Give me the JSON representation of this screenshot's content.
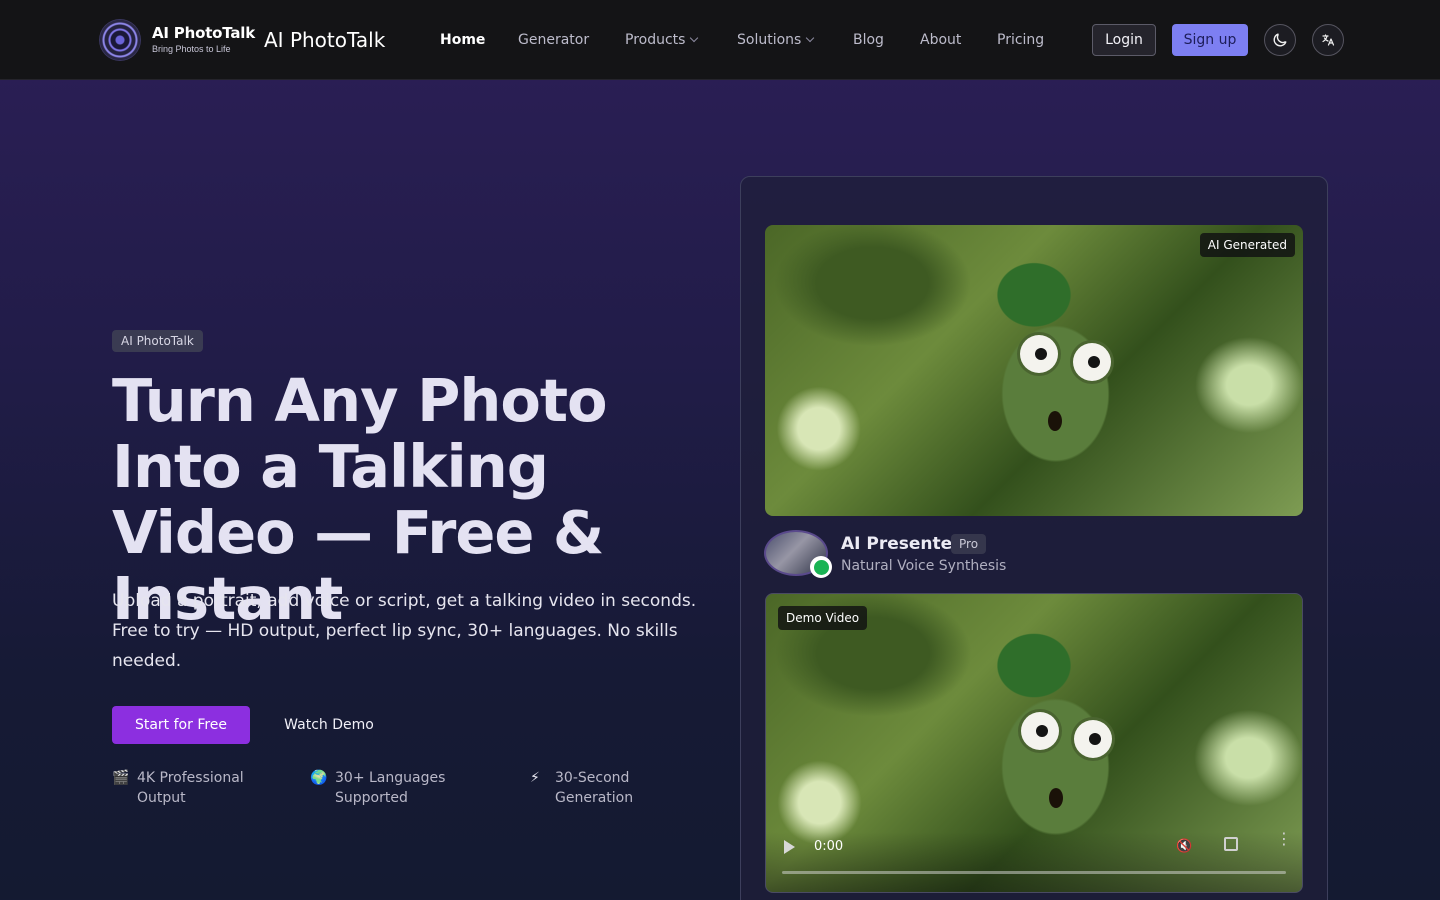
{
  "nav": {
    "logo_title": "AI PhotoTalk",
    "logo_tagline": "Bring Photos to Life",
    "brand": "AI PhotoTalk",
    "links": [
      {
        "label": "Home",
        "active": true
      },
      {
        "label": "Generator",
        "active": false
      },
      {
        "label": "Products",
        "active": false,
        "dropdown": true
      },
      {
        "label": "Solutions",
        "active": false,
        "dropdown": true
      },
      {
        "label": "Blog",
        "active": false
      },
      {
        "label": "About",
        "active": false
      },
      {
        "label": "Pricing",
        "active": false
      }
    ],
    "login_label": "Login",
    "signup_label": "Sign up",
    "theme_icon": "moon-icon",
    "language_icon": "translate-icon"
  },
  "hero": {
    "tag": "AI PhotoTalk",
    "headline": "Turn Any Photo Into a Talking Video — Free & Instant",
    "subtext": "Upload a portrait, add voice or script, get a talking video in seconds. Free to try — HD output, perfect lip sync, 30+ languages. No skills needed.",
    "start_label": "Start for Free",
    "demo_label": "Watch Demo",
    "features": [
      {
        "icon": "🎬",
        "icon_name": "clapperboard-icon",
        "text": "4K Professional Output"
      },
      {
        "icon": "🌍",
        "icon_name": "globe-icon",
        "text": "30+ Languages Supported"
      },
      {
        "icon": "⚡",
        "icon_name": "lightning-icon",
        "text": "30-Second Generation"
      }
    ]
  },
  "showcase": {
    "image_badge": "AI Generated",
    "presenter_name": "AI Presenter",
    "presenter_badge": "Pro",
    "presenter_subtitle": "Natural Voice Synthesis",
    "video_badge": "Demo Video",
    "video_time": "0:00"
  },
  "colors": {
    "accent_purple": "#8c2fe0",
    "signup_blue": "#7d7ff2",
    "online_green": "#19b354"
  }
}
